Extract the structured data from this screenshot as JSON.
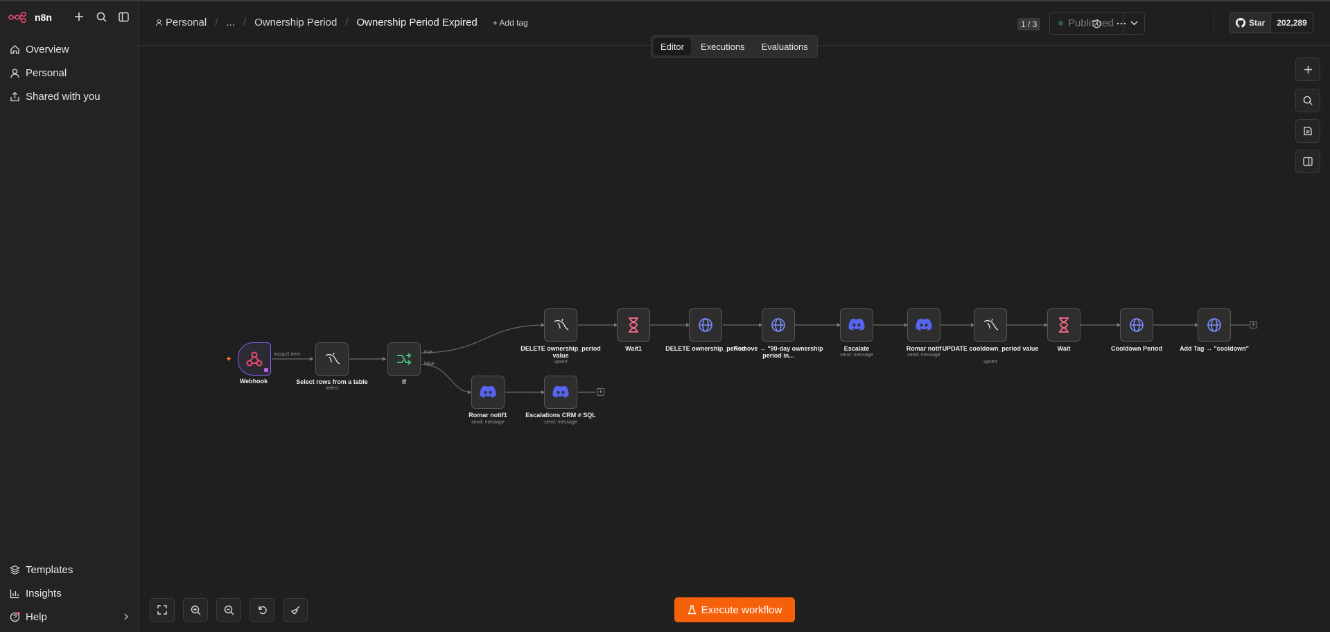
{
  "app": {
    "name": "n8n"
  },
  "sidebar": {
    "nav_top": [
      {
        "label": "Overview",
        "icon": "home-icon"
      },
      {
        "label": "Personal",
        "icon": "user-icon"
      },
      {
        "label": "Shared with you",
        "icon": "share-icon"
      }
    ],
    "nav_bottom": [
      {
        "label": "Templates",
        "icon": "templates-icon"
      },
      {
        "label": "Insights",
        "icon": "insights-icon"
      },
      {
        "label": "Help",
        "icon": "help-icon"
      }
    ]
  },
  "header": {
    "breadcrumb": {
      "project": "Personal",
      "ellipsis": "...",
      "folder": "Ownership Period",
      "workflow": "Ownership Period Expired"
    },
    "add_tag": "+ Add tag",
    "version": "1 / 3",
    "publish_label": "Published",
    "github_star": "Star",
    "github_count": "202,289"
  },
  "tabs": [
    {
      "label": "Editor",
      "active": true
    },
    {
      "label": "Executions",
      "active": false
    },
    {
      "label": "Evaluations",
      "active": false
    }
  ],
  "nodes": {
    "webhook": {
      "label": "Webhook",
      "sub": "",
      "icon": "webhook-icon"
    },
    "select_rows": {
      "label": "Select rows from a table",
      "sub": "select",
      "icon": "mysql-icon"
    },
    "if": {
      "label": "If",
      "sub": "",
      "icon": "if-icon"
    },
    "delete_value": {
      "label": "DELETE ownership_period value",
      "sub": "upsert",
      "icon": "mysql-icon"
    },
    "wait1": {
      "label": "Wait1",
      "sub": "",
      "icon": "hourglass-icon"
    },
    "delete_op": {
      "label": "DELETE ownership_period",
      "sub": "",
      "icon": "globe-icon"
    },
    "remove_tag": {
      "label": "Remove → \"90-day ownership period in...",
      "sub": "",
      "icon": "globe-icon"
    },
    "escalate": {
      "label": "Escalate",
      "sub": "send: message",
      "icon": "discord-icon"
    },
    "romar_notif": {
      "label": "Romar notif",
      "sub": "send: message",
      "icon": "discord-icon"
    },
    "update_cooldown": {
      "label": "UPDATE cooldown_period value",
      "sub": "upsert",
      "icon": "mysql-icon"
    },
    "wait": {
      "label": "Wait",
      "sub": "",
      "icon": "hourglass-icon"
    },
    "cooldown_period": {
      "label": "Cooldown Period",
      "sub": "",
      "icon": "globe-icon"
    },
    "add_tag_cooldown": {
      "label": "Add Tag → \"cooldown\"",
      "sub": "",
      "icon": "globe-icon"
    },
    "romar_notif1": {
      "label": "Romar notif1",
      "sub": "send: message",
      "icon": "discord-icon"
    },
    "escalations_crm": {
      "label": "Escalations CRM ≠ SQL",
      "sub": "send: message",
      "icon": "discord-icon"
    }
  },
  "edges": {
    "webhook_out": "POST",
    "items": "1 item",
    "if_true": "true",
    "if_false": "false"
  },
  "execute_button": "Execute workflow",
  "colors": {
    "accent": "#f5600a",
    "trigger_border": "#8b5cf6",
    "discord": "#5865f2",
    "if_green": "#3fbf74",
    "wait_pink": "#ff6d8d",
    "globe_blue": "#7b8cff"
  }
}
